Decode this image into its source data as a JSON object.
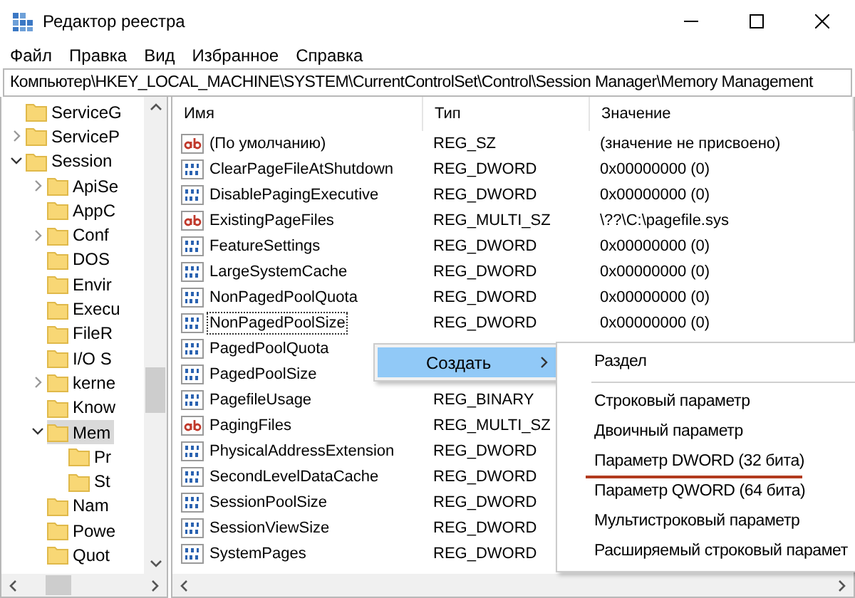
{
  "window": {
    "title": "Редактор реестра"
  },
  "menu": [
    "Файл",
    "Правка",
    "Вид",
    "Избранное",
    "Справка"
  ],
  "address": "Компьютер\\HKEY_LOCAL_MACHINE\\SYSTEM\\CurrentControlSet\\Control\\Session Manager\\Memory Management",
  "tree": [
    {
      "label": "ServiceG",
      "selected": false
    },
    {
      "label": "ServiceP",
      "expanded": false,
      "selected": false
    },
    {
      "label": "Session",
      "expanded": true,
      "selected": false,
      "children": [
        {
          "label": "ApiSe",
          "expanded": false,
          "selected": false
        },
        {
          "label": "AppC",
          "selected": false
        },
        {
          "label": "Conf",
          "expanded": false,
          "selected": false
        },
        {
          "label": "DOS",
          "selected": false
        },
        {
          "label": "Envir",
          "selected": false
        },
        {
          "label": "Execu",
          "selected": false
        },
        {
          "label": "FileR",
          "selected": false
        },
        {
          "label": "I/O S",
          "selected": false
        },
        {
          "label": "kerne",
          "expanded": false,
          "selected": false
        },
        {
          "label": "Know",
          "selected": false
        },
        {
          "label": "Mem",
          "expanded": true,
          "selected": true,
          "children": [
            {
              "label": "Pr",
              "selected": false
            },
            {
              "label": "St",
              "selected": false
            }
          ]
        },
        {
          "label": "Nam",
          "selected": false
        },
        {
          "label": "Powe",
          "selected": false
        },
        {
          "label": "Quot",
          "selected": false
        }
      ]
    }
  ],
  "table": {
    "columns": [
      "Имя",
      "Тип",
      "Значение"
    ],
    "rows": [
      {
        "kind": "string",
        "name": "(По умолчанию)",
        "type": "REG_SZ",
        "value": "(значение не присвоено)",
        "focused": false
      },
      {
        "kind": "binary",
        "name": "ClearPageFileAtShutdown",
        "type": "REG_DWORD",
        "value": "0x00000000 (0)",
        "focused": false
      },
      {
        "kind": "binary",
        "name": "DisablePagingExecutive",
        "type": "REG_DWORD",
        "value": "0x00000000 (0)",
        "focused": false
      },
      {
        "kind": "string",
        "name": "ExistingPageFiles",
        "type": "REG_MULTI_SZ",
        "value": "\\??\\C:\\pagefile.sys",
        "focused": false
      },
      {
        "kind": "binary",
        "name": "FeatureSettings",
        "type": "REG_DWORD",
        "value": "0x00000000 (0)",
        "focused": false
      },
      {
        "kind": "binary",
        "name": "LargeSystemCache",
        "type": "REG_DWORD",
        "value": "0x00000000 (0)",
        "focused": false
      },
      {
        "kind": "binary",
        "name": "NonPagedPoolQuota",
        "type": "REG_DWORD",
        "value": "0x00000000 (0)",
        "focused": false
      },
      {
        "kind": "binary",
        "name": "NonPagedPoolSize",
        "type": "REG_DWORD",
        "value": "0x00000000 (0)",
        "focused": true
      },
      {
        "kind": "binary",
        "name": "PagedPoolQuota",
        "focused": false
      },
      {
        "kind": "binary",
        "name": "PagedPoolSize",
        "focused": false
      },
      {
        "kind": "binary",
        "name": "PagefileUsage",
        "type": "REG_BINARY",
        "focused": false
      },
      {
        "kind": "string",
        "name": "PagingFiles",
        "type": "REG_MULTI_SZ",
        "focused": false
      },
      {
        "kind": "binary",
        "name": "PhysicalAddressExtension",
        "type": "REG_DWORD",
        "focused": false
      },
      {
        "kind": "binary",
        "name": "SecondLevelDataCache",
        "type": "REG_DWORD",
        "focused": false
      },
      {
        "kind": "binary",
        "name": "SessionPoolSize",
        "type": "REG_DWORD",
        "focused": false
      },
      {
        "kind": "binary",
        "name": "SessionViewSize",
        "type": "REG_DWORD",
        "focused": false
      },
      {
        "kind": "binary",
        "name": "SystemPages",
        "type": "REG_DWORD",
        "focused": false
      }
    ]
  },
  "context_menu": {
    "items": [
      {
        "label": "Создать",
        "selected": true,
        "submenu": true
      }
    ]
  },
  "submenu": {
    "items": [
      {
        "kind": "item",
        "label": "Раздел",
        "underlined": false
      },
      {
        "kind": "separator"
      },
      {
        "kind": "item",
        "label": "Строковый параметр",
        "underlined": false
      },
      {
        "kind": "item",
        "label": "Двоичный параметр",
        "underlined": false
      },
      {
        "kind": "item",
        "label": "Параметр DWORD (32 бита)",
        "underlined": true
      },
      {
        "kind": "item",
        "label": "Параметр QWORD (64 бита)",
        "underlined": false
      },
      {
        "kind": "item",
        "label": "Мультистроковый параметр",
        "underlined": false
      },
      {
        "kind": "item",
        "label": "Расширяемый строковый парамет",
        "underlined": false
      }
    ]
  }
}
